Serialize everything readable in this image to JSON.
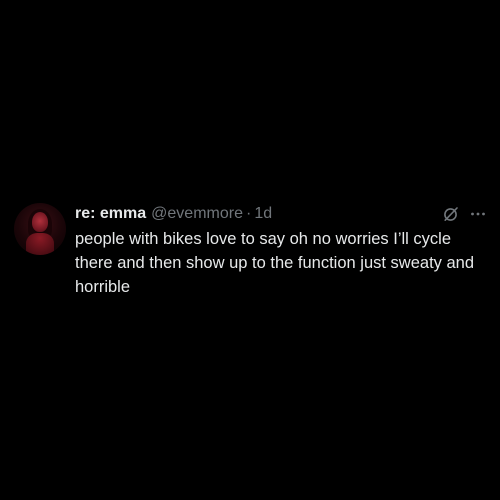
{
  "post": {
    "author": {
      "display_name": "re: emma",
      "handle": "@evemmore",
      "avatar_icon": "profile-photo"
    },
    "separator": "·",
    "timestamp": "1d",
    "text": "people with bikes love to say oh no worries I’ll cycle there and then show up to the function just sweaty and horrible",
    "actions": {
      "grok_icon": "grok-icon",
      "more_icon": "more-icon"
    }
  },
  "colors": {
    "background": "#000000",
    "primary_text": "#e7e9ea",
    "secondary_text": "#71767b"
  }
}
